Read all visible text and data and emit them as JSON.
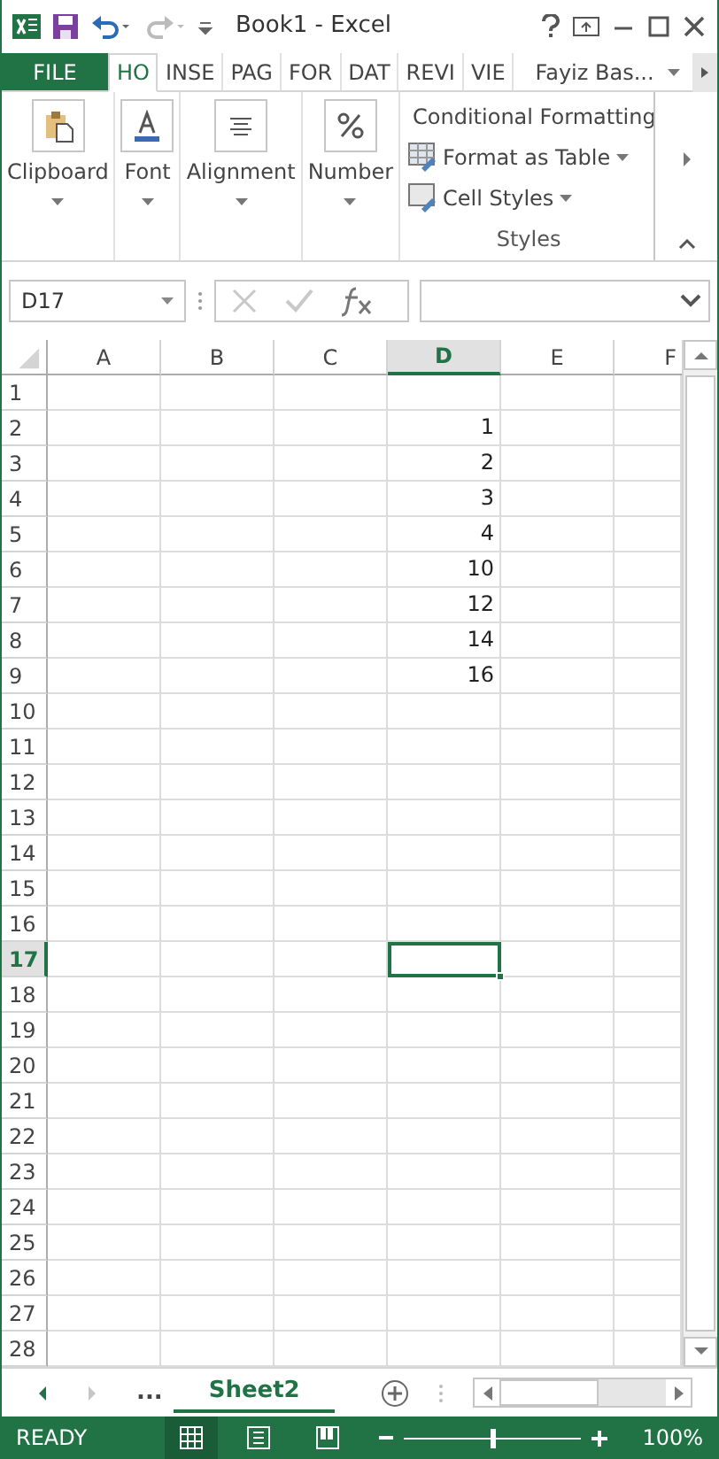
{
  "window": {
    "title": "Book1 - Excel"
  },
  "ribbon_tabs": [
    {
      "label": "FILE",
      "kind": "file",
      "selected": false
    },
    {
      "label": "HO",
      "kind": "tab",
      "selected": true
    },
    {
      "label": "INSE",
      "kind": "tab",
      "selected": false
    },
    {
      "label": "PAG",
      "kind": "tab",
      "selected": false
    },
    {
      "label": "FOR",
      "kind": "tab",
      "selected": false
    },
    {
      "label": "DAT",
      "kind": "tab",
      "selected": false
    },
    {
      "label": "REVI",
      "kind": "tab",
      "selected": false
    },
    {
      "label": "VIE",
      "kind": "tab",
      "selected": false
    }
  ],
  "account": "Fayiz Bas...",
  "ribbon_groups": [
    {
      "label": "Clipboard",
      "kind": "clipboard"
    },
    {
      "label": "Font",
      "kind": "font"
    },
    {
      "label": "Alignment",
      "kind": "alignment"
    },
    {
      "label": "Number",
      "kind": "number"
    }
  ],
  "styles_group": {
    "label": "Styles",
    "commands": [
      {
        "label": "Conditional Formatting",
        "kind": "conditional"
      },
      {
        "label": "Format as Table",
        "kind": "table",
        "dropdown": true
      },
      {
        "label": "Cell Styles",
        "kind": "styles",
        "dropdown": true
      }
    ]
  },
  "name_box": "D17",
  "columns": [
    {
      "label": "A",
      "selected": false
    },
    {
      "label": "B",
      "selected": false
    },
    {
      "label": "C",
      "selected": false
    },
    {
      "label": "D",
      "selected": true
    },
    {
      "label": "E",
      "selected": false
    },
    {
      "label": "F",
      "selected": false
    }
  ],
  "rows": [
    {
      "header": "1",
      "selected": false
    },
    {
      "header": "2",
      "selected": false,
      "d": "1"
    },
    {
      "header": "3",
      "selected": false,
      "d": "2"
    },
    {
      "header": "4",
      "selected": false,
      "d": "3"
    },
    {
      "header": "5",
      "selected": false,
      "d": "4"
    },
    {
      "header": "6",
      "selected": false,
      "d": "10"
    },
    {
      "header": "7",
      "selected": false,
      "d": "12"
    },
    {
      "header": "8",
      "selected": false,
      "d": "14"
    },
    {
      "header": "9",
      "selected": false,
      "d": "16"
    },
    {
      "header": "10",
      "selected": false
    },
    {
      "header": "11",
      "selected": false
    },
    {
      "header": "12",
      "selected": false
    },
    {
      "header": "13",
      "selected": false
    },
    {
      "header": "14",
      "selected": false
    },
    {
      "header": "15",
      "selected": false
    },
    {
      "header": "16",
      "selected": false
    },
    {
      "header": "17",
      "selected": true
    },
    {
      "header": "18",
      "selected": false
    },
    {
      "header": "19",
      "selected": false
    },
    {
      "header": "20",
      "selected": false
    },
    {
      "header": "21",
      "selected": false
    },
    {
      "header": "22",
      "selected": false
    },
    {
      "header": "23",
      "selected": false
    },
    {
      "header": "24",
      "selected": false
    },
    {
      "header": "25",
      "selected": false
    },
    {
      "header": "26",
      "selected": false
    },
    {
      "header": "27",
      "selected": false
    },
    {
      "header": "28",
      "selected": false
    }
  ],
  "sheet_overflow": "...",
  "sheet_tabs": [
    {
      "label": "Sheet2",
      "selected": true
    }
  ],
  "status": "READY",
  "views": [
    {
      "kind": "normal",
      "selected": true
    },
    {
      "kind": "page-layout",
      "selected": false
    },
    {
      "kind": "page-break",
      "selected": false
    }
  ],
  "zoom": {
    "level": 0.5,
    "reading": "100%"
  }
}
